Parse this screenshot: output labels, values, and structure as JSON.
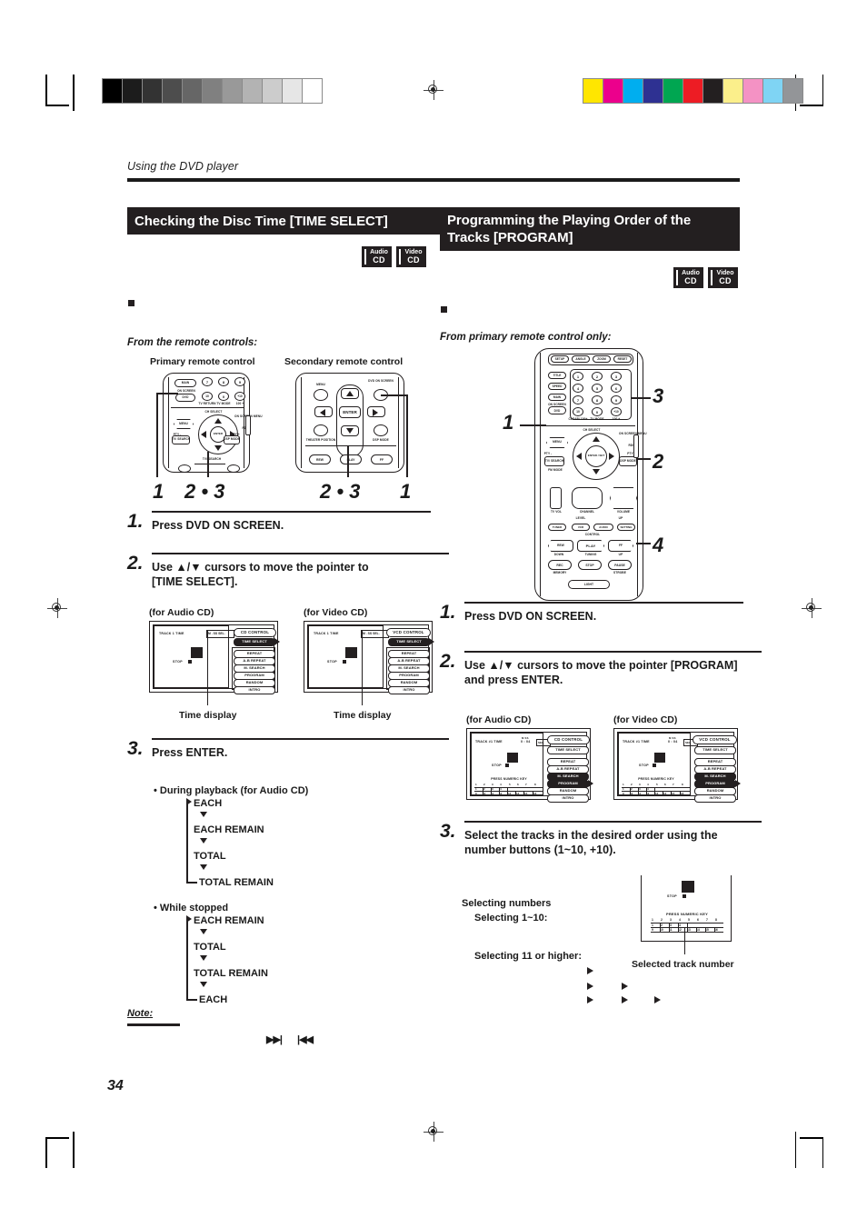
{
  "page": {
    "running_head": "Using the DVD player",
    "page_number": "34"
  },
  "printer_marks": {
    "gray_bar": [
      "#000000",
      "#1c1c1c",
      "#333333",
      "#4d4d4d",
      "#666666",
      "#808080",
      "#999999",
      "#b3b3b3",
      "#cccccc",
      "#e6e6e6",
      "#ffffff"
    ],
    "color_bar": [
      "#ffe600",
      "#ec008c",
      "#00aeef",
      "#2e3192",
      "#00a651",
      "#ed1c24",
      "#231f20",
      "#fbef8b",
      "#f492c4",
      "#7fd4f4",
      "#939598"
    ]
  },
  "left_column": {
    "section_title": "Checking the Disc Time [TIME SELECT]",
    "badges": [
      {
        "top": "Audio",
        "bottom": "CD"
      },
      {
        "top": "Video",
        "bottom": "CD"
      }
    ],
    "source_line": "From the remote controls:",
    "remote_labels": {
      "primary": "Primary remote control",
      "secondary": "Secondary remote control"
    },
    "callout_numbers": {
      "primary_left": "1",
      "primary_right": "2 • 3",
      "secondary_left": "2 • 3",
      "secondary_right": "1"
    },
    "steps": [
      {
        "num": "1.",
        "text": "Press DVD ON SCREEN."
      },
      {
        "num": "2.",
        "text": "Use ▲/▼ cursors to move the pointer to [TIME SELECT]."
      },
      {
        "num": "3.",
        "text": "Press ENTER."
      }
    ],
    "osd_captions": {
      "audio": "(for Audio CD)",
      "video": "(for Video CD)",
      "time_display": "Time display"
    },
    "osd_audio": {
      "panel_title": "CD CONTROL",
      "track_row": "TRACK    1   TIME",
      "time_value": "M .  SS SEL.",
      "time_units": "M       SS",
      "stop_label": "STOP",
      "menu_items": [
        "TIME SELECT",
        "REPEAT",
        "A-B REPEAT",
        "M. SEARCH",
        "PROGRAM",
        "RANDOM",
        "INTRO"
      ]
    },
    "osd_video": {
      "panel_title": "VCD CONTROL",
      "track_row": "TRACK    1   TIME",
      "time_value": "M .  SS SEL.",
      "time_units": "M       SS",
      "stop_label": "STOP",
      "menu_items": [
        "TIME SELECT",
        "REPEAT",
        "A-B REPEAT",
        "M. SEARCH",
        "PROGRAM",
        "RANDOM",
        "INTRO"
      ]
    },
    "flow_playback": {
      "heading": "During playback (for Audio CD)",
      "items": [
        "EACH",
        "EACH REMAIN",
        "TOTAL",
        "TOTAL REMAIN"
      ]
    },
    "flow_stopped": {
      "heading": "While stopped",
      "items": [
        "EACH REMAIN",
        "TOTAL",
        "TOTAL REMAIN",
        "EACH"
      ]
    },
    "note_label": "Note:",
    "note_icons": [
      "▶▶|",
      "|◀◀"
    ]
  },
  "right_column": {
    "section_title_line1": "Programming the Playing Order of the",
    "section_title_line2": "Tracks [PROGRAM]",
    "badges": [
      {
        "top": "Audio",
        "bottom": "CD"
      },
      {
        "top": "Video",
        "bottom": "CD"
      }
    ],
    "source_line": "From primary remote control only:",
    "callout_numbers": {
      "one": "1",
      "two": "2",
      "three": "3",
      "four": "4"
    },
    "steps": [
      {
        "num": "1.",
        "text": "Press DVD ON SCREEN."
      },
      {
        "num": "2.",
        "text": "Use ▲/▼ cursors to move the pointer [PROGRAM] and press ENTER."
      },
      {
        "num": "3.",
        "text": "Select the tracks in the desired order using the number buttons (1~10, +10)."
      }
    ],
    "osd_captions": {
      "audio": "(for Audio CD)",
      "video": "(for Video CD)"
    },
    "osd_audio": {
      "panel_title": "CD CONTROL",
      "track_row": "TRACK   #1   TIME",
      "time_value": "0 : 04",
      "time_units": "M        SS",
      "sel_label": "SEL.",
      "stop_label": "STOP",
      "numeric_prompt": "PRESS NUMERIC KEY",
      "program_slots": [
        "1",
        "2",
        "3",
        "4"
      ],
      "slot_labels": [
        "1",
        "2",
        "3",
        "4",
        "5",
        "6",
        "7",
        "8"
      ],
      "track_row_low": [
        "1",
        "2",
        "3",
        "4",
        "5",
        "6",
        "7",
        "8"
      ],
      "track_row_high": [
        "9",
        "10",
        "11",
        "12",
        "13",
        "14",
        "15",
        "16"
      ],
      "menu_items": [
        "TIME SELECT",
        "REPEAT",
        "A-B REPEAT",
        "M. SEARCH",
        "PROGRAM",
        "RANDOM",
        "INTRO"
      ]
    },
    "osd_video": {
      "panel_title": "VCD CONTROL",
      "track_row": "TRACK   #1   TIME",
      "time_value": "0 : 04",
      "time_units": "M        SS",
      "sel_label": "SEL.",
      "stop_label": "STOP",
      "numeric_prompt": "PRESS NUMERIC KEY",
      "program_slots": [
        "1",
        "2",
        "3",
        "4"
      ],
      "track_row_low": [
        "1",
        "2",
        "3",
        "4",
        "5",
        "6",
        "7",
        "8"
      ],
      "track_row_high": [
        "9",
        "10",
        "11",
        "12",
        "13",
        "14",
        "15",
        "16"
      ],
      "menu_items": [
        "TIME SELECT",
        "REPEAT",
        "A-B REPEAT",
        "M. SEARCH",
        "PROGRAM",
        "RANDOM",
        "INTRO"
      ]
    },
    "selection_help": {
      "heading": "Selecting numbers",
      "line_1_10": "Selecting 1~10:",
      "line_11_plus": "Selecting 11 or higher:"
    },
    "track_caption": "Selected track number",
    "detail_osd": {
      "stop_label": "STOP",
      "numeric_prompt": "PRESS NUMERIC KEY",
      "slots": [
        "1",
        "2",
        "3",
        "4"
      ],
      "row_low": [
        "1",
        "2",
        "3",
        "4",
        "5",
        "6",
        "7",
        "8"
      ],
      "row_high": [
        "9",
        "10",
        "11",
        "12",
        "13",
        "14",
        "15",
        "16"
      ]
    }
  },
  "remotes": {
    "primary_small": {
      "keys_row1": [
        "7",
        "8",
        "9"
      ],
      "keys_row2": [
        "10",
        "0",
        "+10"
      ],
      "sub_row2": [
        "TV RETURN",
        "TV MODE",
        "100 +"
      ],
      "main_btn": "MAIN",
      "dvd_btn": "DVD",
      "on_screen_label": "ON SCREEN",
      "menu_btn": "MENU",
      "enter_label": "ENTER",
      "sub_label": "EXIT",
      "dsp_label": "DSP MODE",
      "left_label": "PTY -",
      "right_label": "PTY +",
      "ch_select": "CH SELECT",
      "tv_search": "TV/ SEARCH",
      "on_screen_menu": "ON SCREEN MENU",
      "rds_label": "RDS"
    },
    "secondary": {
      "menu_btn": "MENU",
      "dvd_on_screen": "DVD ON SCREEN",
      "enter_btn": "ENTER",
      "theater_position": "THEATER POSITION",
      "dsp_mode": "DSP MODE",
      "transport": [
        "REW",
        "PLAY",
        "FF"
      ]
    },
    "primary_large": {
      "top_row": [
        "SETUP",
        "ANGLE",
        "ZOOM",
        "RESET"
      ],
      "keys": [
        "1",
        "2",
        "3",
        "4",
        "5",
        "6",
        "7",
        "8",
        "9",
        "10",
        "0",
        "+10"
      ],
      "key_sub": [
        "CLEAR/ 100+",
        "TV MODE",
        "100 +"
      ],
      "side_keys": [
        "TITLE",
        "SPEED",
        "MAIN",
        "DVD"
      ],
      "on_screen": "ON SCREEN",
      "menu": "MENU",
      "enter": "ENTER / SET",
      "ch_select": "CH SELECT",
      "on_screen_menu": "ON SCREEN MENU",
      "rds": "RDS",
      "pty_minus": "PTY -",
      "pty_plus": "PTY +",
      "dsp_mode": "DSP MODE",
      "tv_search": "TV/ SEARCH",
      "fm_mode": "FM MODE",
      "tv_vol": "TV VOL",
      "channel": "CHANNEL",
      "volume": "VOLUME",
      "level": "LEVEL",
      "up": "UP",
      "down": "DOWN",
      "tuning": "TUNING",
      "control_label": "CONTROL",
      "source_keys": [
        "TUNER",
        "VCR",
        "AUDIO",
        "SETTING"
      ],
      "transport": [
        "REW",
        "PLAY",
        "FF"
      ],
      "bottom_keys": [
        "REC",
        "STOP",
        "PAUSE"
      ],
      "bottom_sub": [
        "MEMORY",
        "",
        "STROBE"
      ],
      "light": "LIGHT"
    }
  }
}
